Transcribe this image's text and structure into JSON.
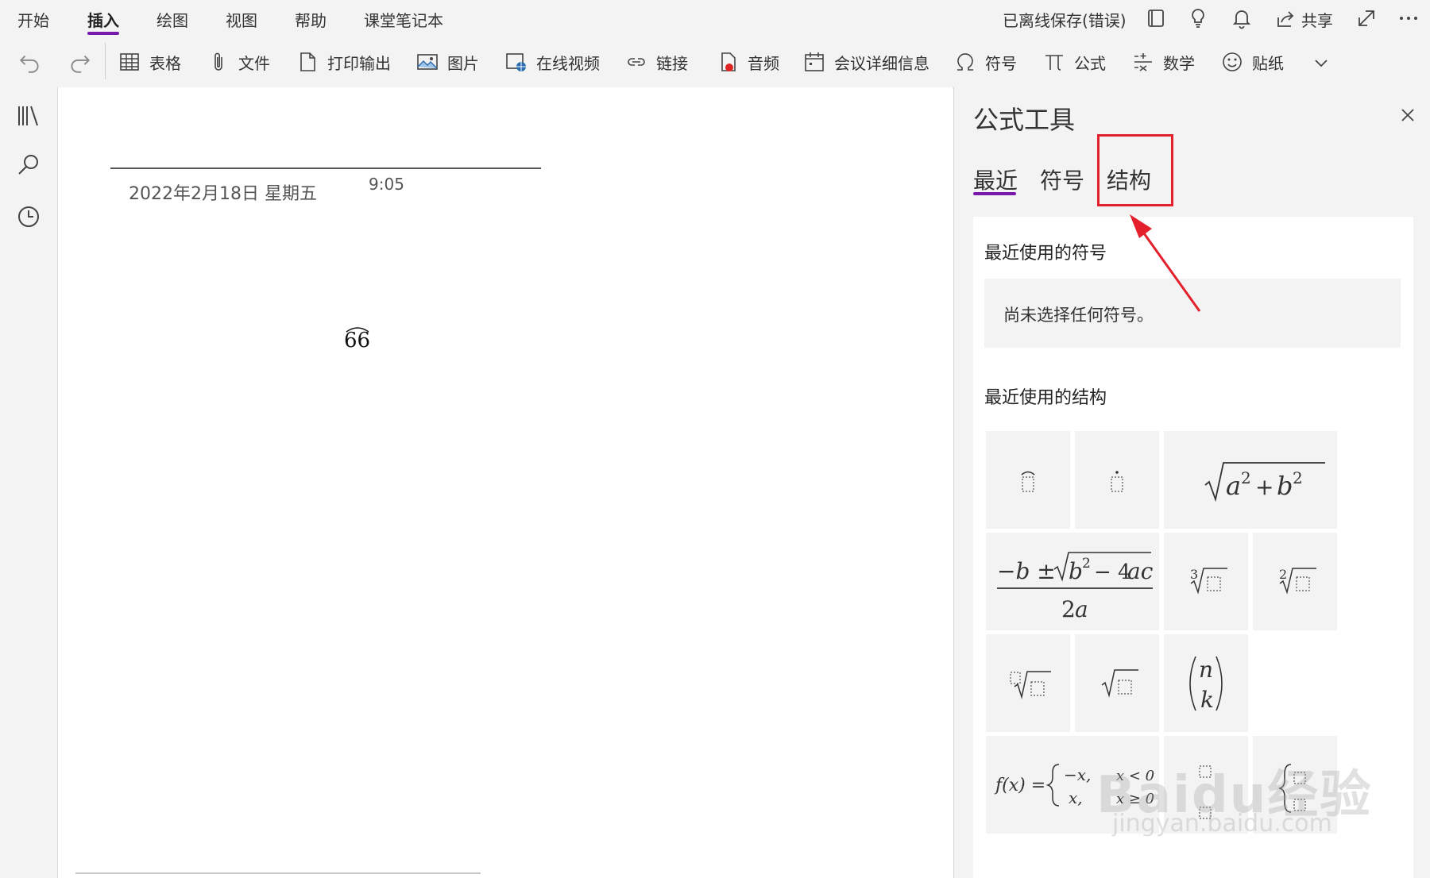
{
  "tabs": [
    {
      "label": "开始"
    },
    {
      "label": "插入",
      "active": true
    },
    {
      "label": "绘图"
    },
    {
      "label": "视图"
    },
    {
      "label": "帮助"
    },
    {
      "label": "课堂笔记本"
    }
  ],
  "status": {
    "text": "已离线保存(错误)"
  },
  "share": {
    "label": "共享"
  },
  "ribbon": {
    "undo_icon": "undo-icon",
    "redo_icon": "redo-icon",
    "items": [
      {
        "label": "表格",
        "icon": "table-icon"
      },
      {
        "label": "文件",
        "icon": "paperclip-icon"
      },
      {
        "label": "打印输出",
        "icon": "file-icon"
      },
      {
        "label": "图片",
        "icon": "picture-icon"
      },
      {
        "label": "在线视频",
        "icon": "online-video-icon"
      },
      {
        "label": "链接",
        "icon": "link-icon"
      },
      {
        "label": "音频",
        "icon": "audio-icon"
      },
      {
        "label": "会议详细信息",
        "icon": "calendar-icon"
      },
      {
        "label": "符号",
        "icon": "omega-icon"
      },
      {
        "label": "公式",
        "icon": "pi-icon"
      },
      {
        "label": "数学",
        "icon": "math-icon"
      },
      {
        "label": "贴纸",
        "icon": "sticker-icon"
      }
    ]
  },
  "page": {
    "date": "2022年2月18日 星期五",
    "time": "9:05",
    "equation": "66"
  },
  "pane": {
    "title": "公式工具",
    "tabs": [
      {
        "label": "最近",
        "active": true
      },
      {
        "label": "符号"
      },
      {
        "label": "结构",
        "highlighted": true
      }
    ],
    "recent_symbols_heading": "最近使用的符号",
    "recent_symbols_empty": "尚未选择任何符号。",
    "recent_structures_heading": "最近使用的结构"
  },
  "watermark": {
    "text": "Baidu经验",
    "url": "jingyan.baidu.com"
  },
  "colors": {
    "accent": "#7719aa",
    "highlight": "#e3202b",
    "chrome": "#f3f3f3"
  }
}
